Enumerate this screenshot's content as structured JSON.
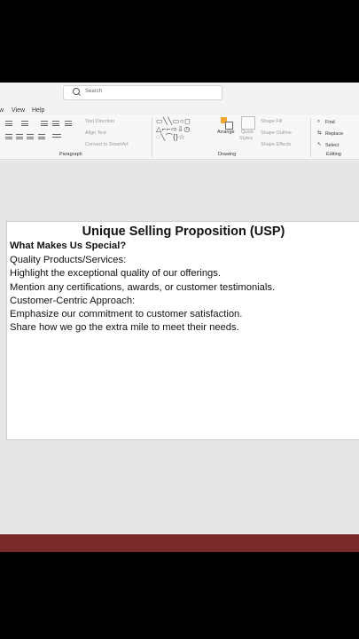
{
  "menu": {
    "items": [
      "w",
      "View",
      "Help"
    ]
  },
  "search": {
    "placeholder": "Search"
  },
  "ribbon": {
    "paragraph": {
      "label": "Paragraph",
      "text_direction": "Text Direction",
      "align_text": "Align Text",
      "convert_smartart": "Convert to SmartArt"
    },
    "drawing": {
      "label": "Drawing",
      "arrange": "Arrange",
      "quick_styles_1": "Quick",
      "quick_styles_2": "Styles",
      "shape_fill": "Shape Fill",
      "shape_outline": "Shape Outline",
      "shape_effects": "Shape Effects"
    },
    "editing": {
      "label": "Editing",
      "find": "Find",
      "replace": "Replace",
      "select": "Select"
    }
  },
  "slide": {
    "title": "Unique Selling Proposition (USP)",
    "heading": "What Makes Us Special?",
    "lines": [
      "Quality Products/Services:",
      "Highlight the exceptional quality of our offerings.",
      "Mention any certifications, awards, or customer testimonials.",
      "Customer-Centric Approach:",
      "Emphasize our commitment to customer satisfaction.",
      "Share how we go the extra mile to meet their needs."
    ]
  }
}
